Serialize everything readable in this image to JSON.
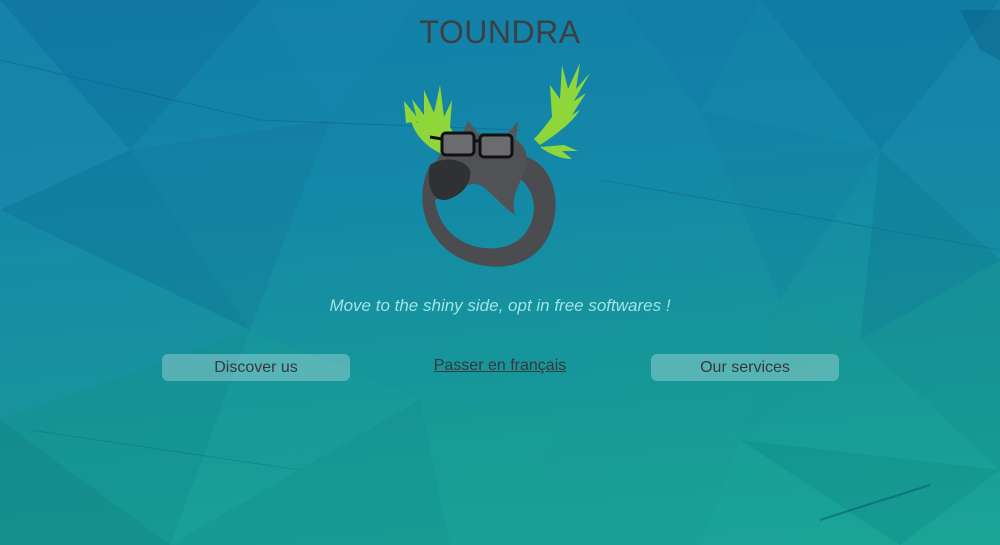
{
  "site": {
    "title": "TOUNDRA",
    "tagline": "Move to the shiny side, opt in free softwares !",
    "logo_icon": "moose-head-with-glasses-icon"
  },
  "nav": {
    "discover_label": "Discover us",
    "language_label": "Passer en français",
    "services_label": "Our services"
  },
  "colors": {
    "antler_green": "#8fd63a",
    "moose_gray": "#4a4c50",
    "tagline": "#9ee4e4",
    "text_dark": "#3c3f44"
  }
}
